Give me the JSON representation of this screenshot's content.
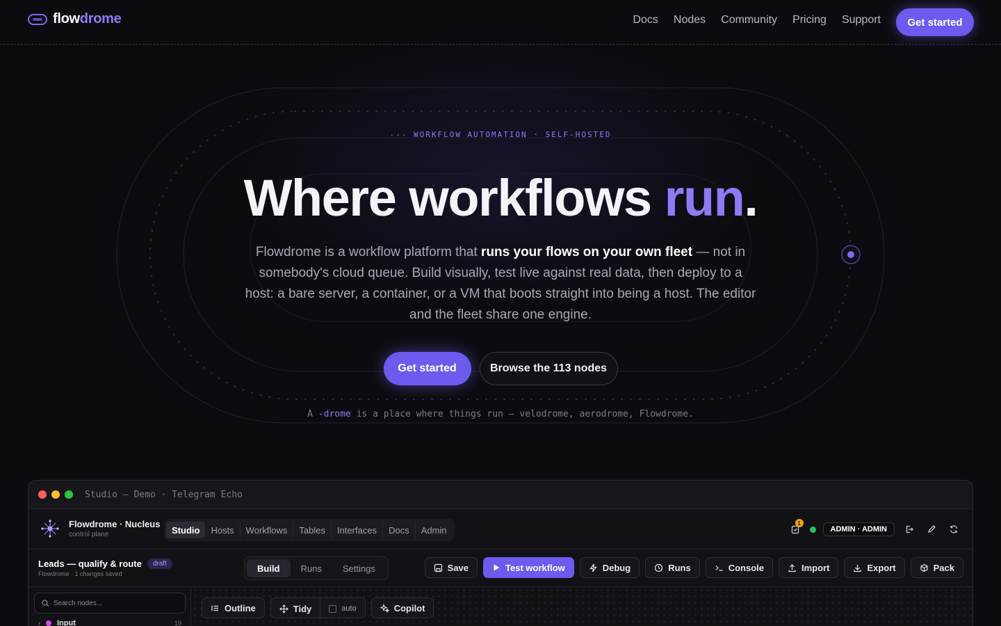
{
  "nav": {
    "logo_part1": "flow",
    "logo_part2": "drome",
    "links": [
      "Docs",
      "Nodes",
      "Community",
      "Pricing",
      "Support"
    ],
    "cta": "Get started"
  },
  "hero": {
    "eyebrow": "--- WORKFLOW AUTOMATION · SELF-HOSTED",
    "headline_main": "Where workflows ",
    "headline_accent": "run",
    "headline_end": ".",
    "lede_1": "Flowdrome is a workflow platform that ",
    "lede_bold": "runs your flows on your own fleet",
    "lede_2": " — not in somebody's cloud queue. Build visually, test live against real data, then deploy to a host: a bare server, a container, or a VM that boots straight into being a host. The editor and the fleet share one engine.",
    "primary_button": "Get started",
    "secondary_button": "Browse the 113 nodes",
    "footnote_1": "A ",
    "footnote_accent": "-drome",
    "footnote_2": " is a place where things run — velodrome, aerodrome, Flowdrome."
  },
  "app_window": {
    "title": "Studio — Demo · Telegram Echo",
    "brand_name": "Flowdrome · Nucleus",
    "brand_sub": "control plane",
    "tabs": [
      "Studio",
      "Hosts",
      "Workflows",
      "Tables",
      "Interfaces",
      "Docs",
      "Admin"
    ],
    "active_tab": "Studio",
    "notification_count": "1",
    "user_badge": "ADMIN · ADMIN",
    "workflow_name": "Leads — qualify & route",
    "workflow_status": "draft",
    "workflow_sub": "Flowdrome · 1 changes saved",
    "modes": [
      "Build",
      "Runs",
      "Settings"
    ],
    "active_mode": "Build",
    "actions": {
      "save": "Save",
      "test": "Test workflow",
      "debug": "Debug",
      "runs": "Runs",
      "console": "Console",
      "import": "Import",
      "export": "Export",
      "pack": "Pack"
    },
    "search_placeholder": "Search nodes...",
    "sidebar_item": "Input",
    "sidebar_item_count": "19",
    "canvas_tools": {
      "outline": "Outline",
      "tidy": "Tidy",
      "auto": "auto",
      "copilot": "Copilot"
    }
  },
  "colors": {
    "accent": "#8b7cf6",
    "button": "#6d5bef",
    "background": "#0c0c10",
    "status_live": "#22c55e",
    "notification": "#f59e0b"
  }
}
